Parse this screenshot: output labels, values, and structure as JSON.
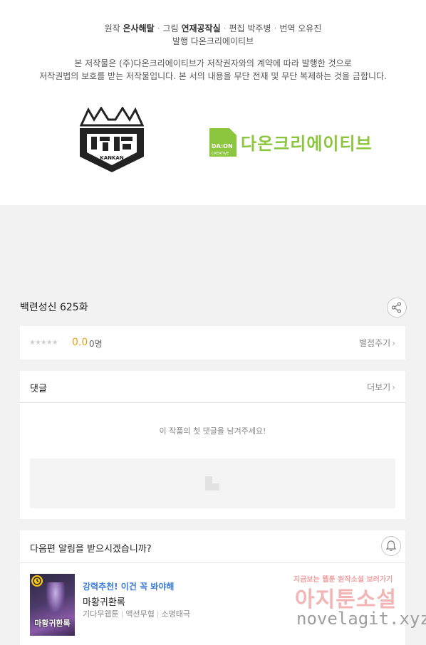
{
  "credits": {
    "original_label": "원작",
    "original_value": "은사해탈",
    "art_label": "그림",
    "art_value": "연재공작실",
    "editor_label": "편집",
    "editor_value": "박주병",
    "translation_label": "번역",
    "translation_value": "오유진",
    "publisher_label": "발행",
    "publisher_value": "다온크리에이티브",
    "notice_line1": "본 저작물은 (주)다온크리에이티브가 저작권자와의 계약에 따라 발행한 것으로",
    "notice_line2": "저작권법의 보호를 받는 저작물입니다. 본 서의 내용을 무단 전재 및 무단 복제하는 것을 금합니다."
  },
  "logos": {
    "kuaikan_text": "KANKAN",
    "daon_badge_top": "DA:ON",
    "daon_badge_bottom": "CREATIVE",
    "daon_text": "다온크리에이티브",
    "daon_color": "#8cc63f"
  },
  "episode": {
    "title": "백련성신 625화",
    "share_icon": "share-icon"
  },
  "rating": {
    "stars": "★★★★★",
    "score": "0.0",
    "count": "0명",
    "rate_link": "별점주기",
    "chevron": "›"
  },
  "comments": {
    "title": "댓글",
    "more_link": "더보기",
    "chevron": "›",
    "empty_message": "이 작품의 첫 댓글을 남겨주세요!"
  },
  "notify": {
    "question": "다음편 알림을 받으시겠습니까?",
    "bell_icon": "bell-icon"
  },
  "recommendation": {
    "promo": "강력추천! 이건 꼭 봐야해",
    "title": "마황귀환록",
    "thumb_title": "마황귀환록",
    "tags": [
      "기다무웹툰",
      "액션무협",
      "소명태극"
    ]
  },
  "watermark": {
    "top": "지금보는 웹툰 원작소설 보러가기",
    "main": "아지툰소설",
    "url": "novelagit.xyz"
  },
  "colors": {
    "accent_score": "#e8a317",
    "promo_blue": "#3b7dd8",
    "page_bg": "#f2f2f2"
  }
}
